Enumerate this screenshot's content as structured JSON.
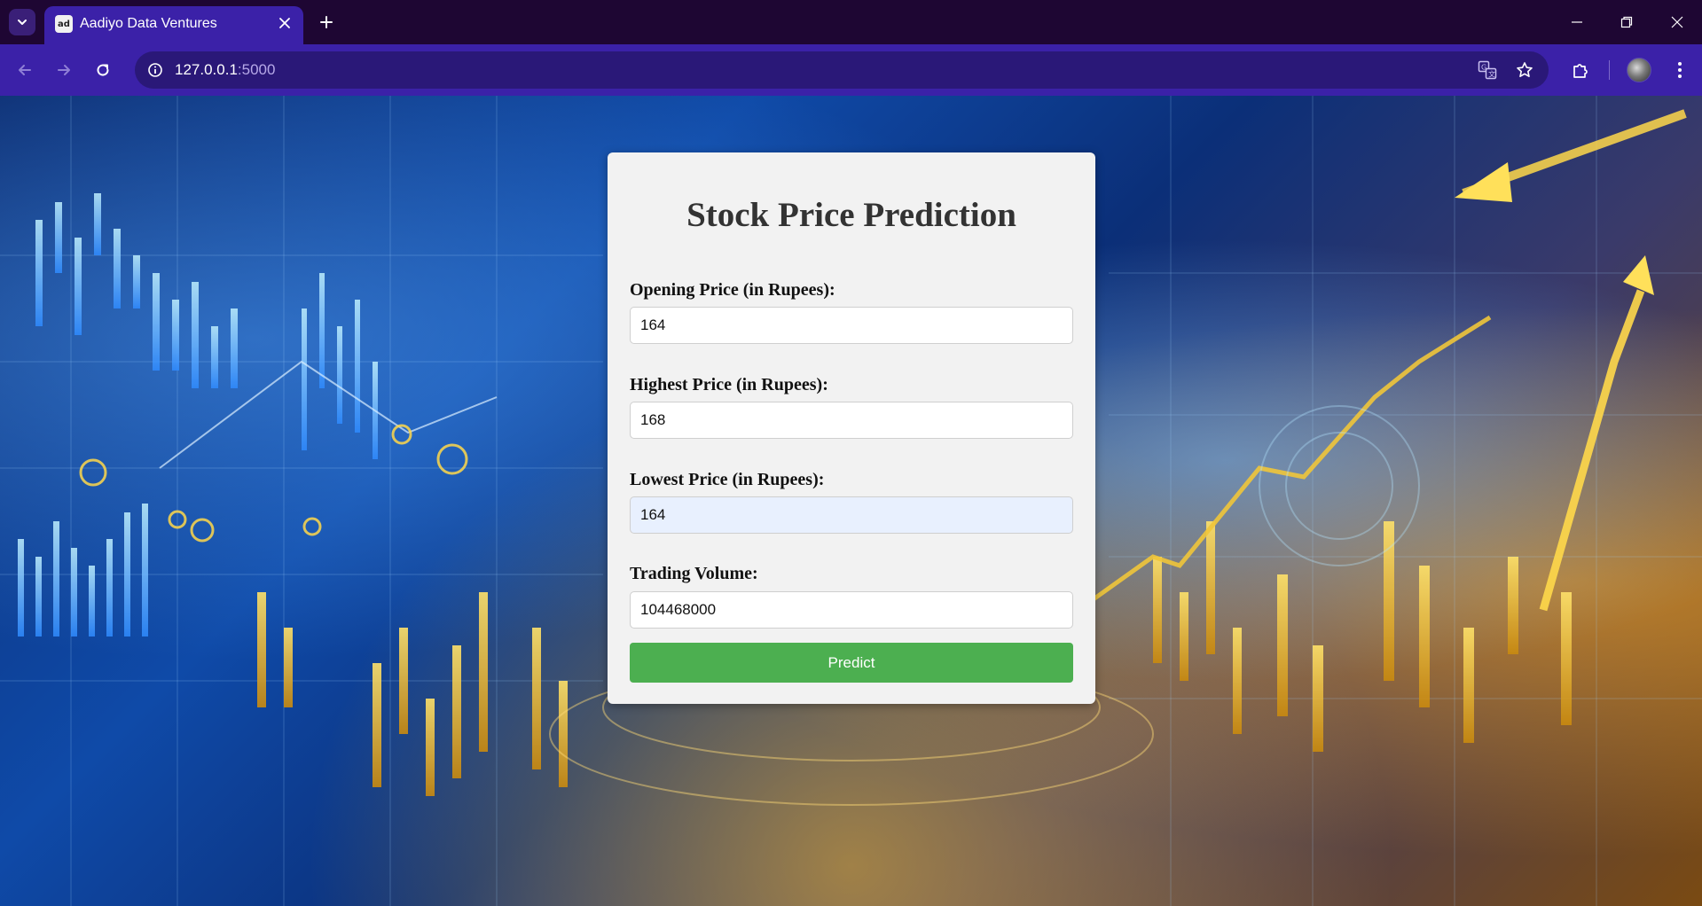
{
  "browser": {
    "tab": {
      "title": "Aadiyo Data Ventures",
      "favicon_text": "ad"
    },
    "address_bar": {
      "host": "127.0.0.1",
      "port": ":5000"
    },
    "icons": {
      "tab_search": "chevron-down-icon",
      "tab_close": "close-icon",
      "new_tab": "plus-icon",
      "back": "arrow-left-icon",
      "forward": "arrow-right-icon",
      "reload": "reload-icon",
      "site_info": "info-icon",
      "translate": "translate-icon",
      "bookmark": "star-icon",
      "extensions": "puzzle-icon",
      "menu": "kebab-menu-icon"
    },
    "colors": {
      "frame": "#1e0633",
      "toolbar": "#3b21a8",
      "omnibox": "#2a1878"
    }
  },
  "page": {
    "title": "Stock Price Prediction",
    "fields": [
      {
        "label": "Opening Price (in Rupees):",
        "value": "164"
      },
      {
        "label": "Highest Price (in Rupees):",
        "value": "168"
      },
      {
        "label": "Lowest Price (in Rupees):",
        "value": "164"
      },
      {
        "label": "Trading Volume:",
        "value": "104468000"
      }
    ],
    "submit_label": "Predict",
    "colors": {
      "card": "#f2f2f2",
      "button": "#4caf50",
      "autofill": "#e8f0fe"
    }
  }
}
